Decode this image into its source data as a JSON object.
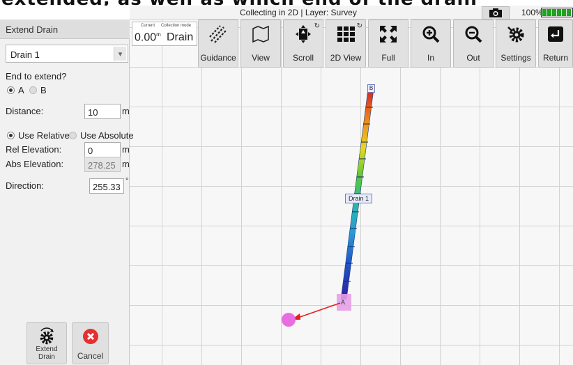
{
  "caption": {
    "text": "extended, as well as which end of the drain"
  },
  "titlebar": {
    "title": "Collecting in 2D | Layer: Survey",
    "battery_pct": "100%",
    "camera_icon": "camera-icon"
  },
  "info": {
    "current_label": "Current",
    "mode_label": "Collection mode",
    "current_value": "0.00",
    "current_unit": "m",
    "mode_value": "Drain"
  },
  "toolbar": {
    "items": [
      {
        "label": "Guidance",
        "icon": "guidance-icon"
      },
      {
        "label": "View",
        "icon": "map-view-icon"
      },
      {
        "label": "Scroll",
        "icon": "scroll-icon"
      },
      {
        "label": "2D View",
        "icon": "grid-view-icon"
      },
      {
        "label": "Full",
        "icon": "full-extent-icon"
      },
      {
        "label": "In",
        "icon": "zoom-in-icon"
      },
      {
        "label": "Out",
        "icon": "zoom-out-icon"
      },
      {
        "label": "Settings",
        "icon": "settings-icon"
      },
      {
        "label": "Return",
        "icon": "return-icon"
      }
    ]
  },
  "panel": {
    "title": "Extend Drain",
    "drain_select": "Drain 1",
    "end_question": "End to extend?",
    "end_options": [
      "A",
      "B"
    ],
    "end_selected": "A",
    "distance_label": "Distance:",
    "distance_value": "10",
    "distance_unit": "m",
    "mode_options": [
      "Use Relative",
      "Use Absolute"
    ],
    "mode_selected": "Use Relative",
    "rel_label": "Rel Elevation:",
    "rel_value": "0",
    "rel_unit": "m",
    "abs_label": "Abs Elevation:",
    "abs_value": "278.25",
    "abs_unit": "m",
    "direction_label": "Direction:",
    "direction_value": "255.33",
    "direction_unit": "°",
    "extend_button": "Extend Drain",
    "cancel_button": "Cancel"
  },
  "map": {
    "drain_label": "Drain 1",
    "end_b_label": "B",
    "end_a_label": "A",
    "colors": {
      "arrow": "#e02020",
      "target": "#e86de0",
      "end_box": "#e6a0e6"
    }
  }
}
